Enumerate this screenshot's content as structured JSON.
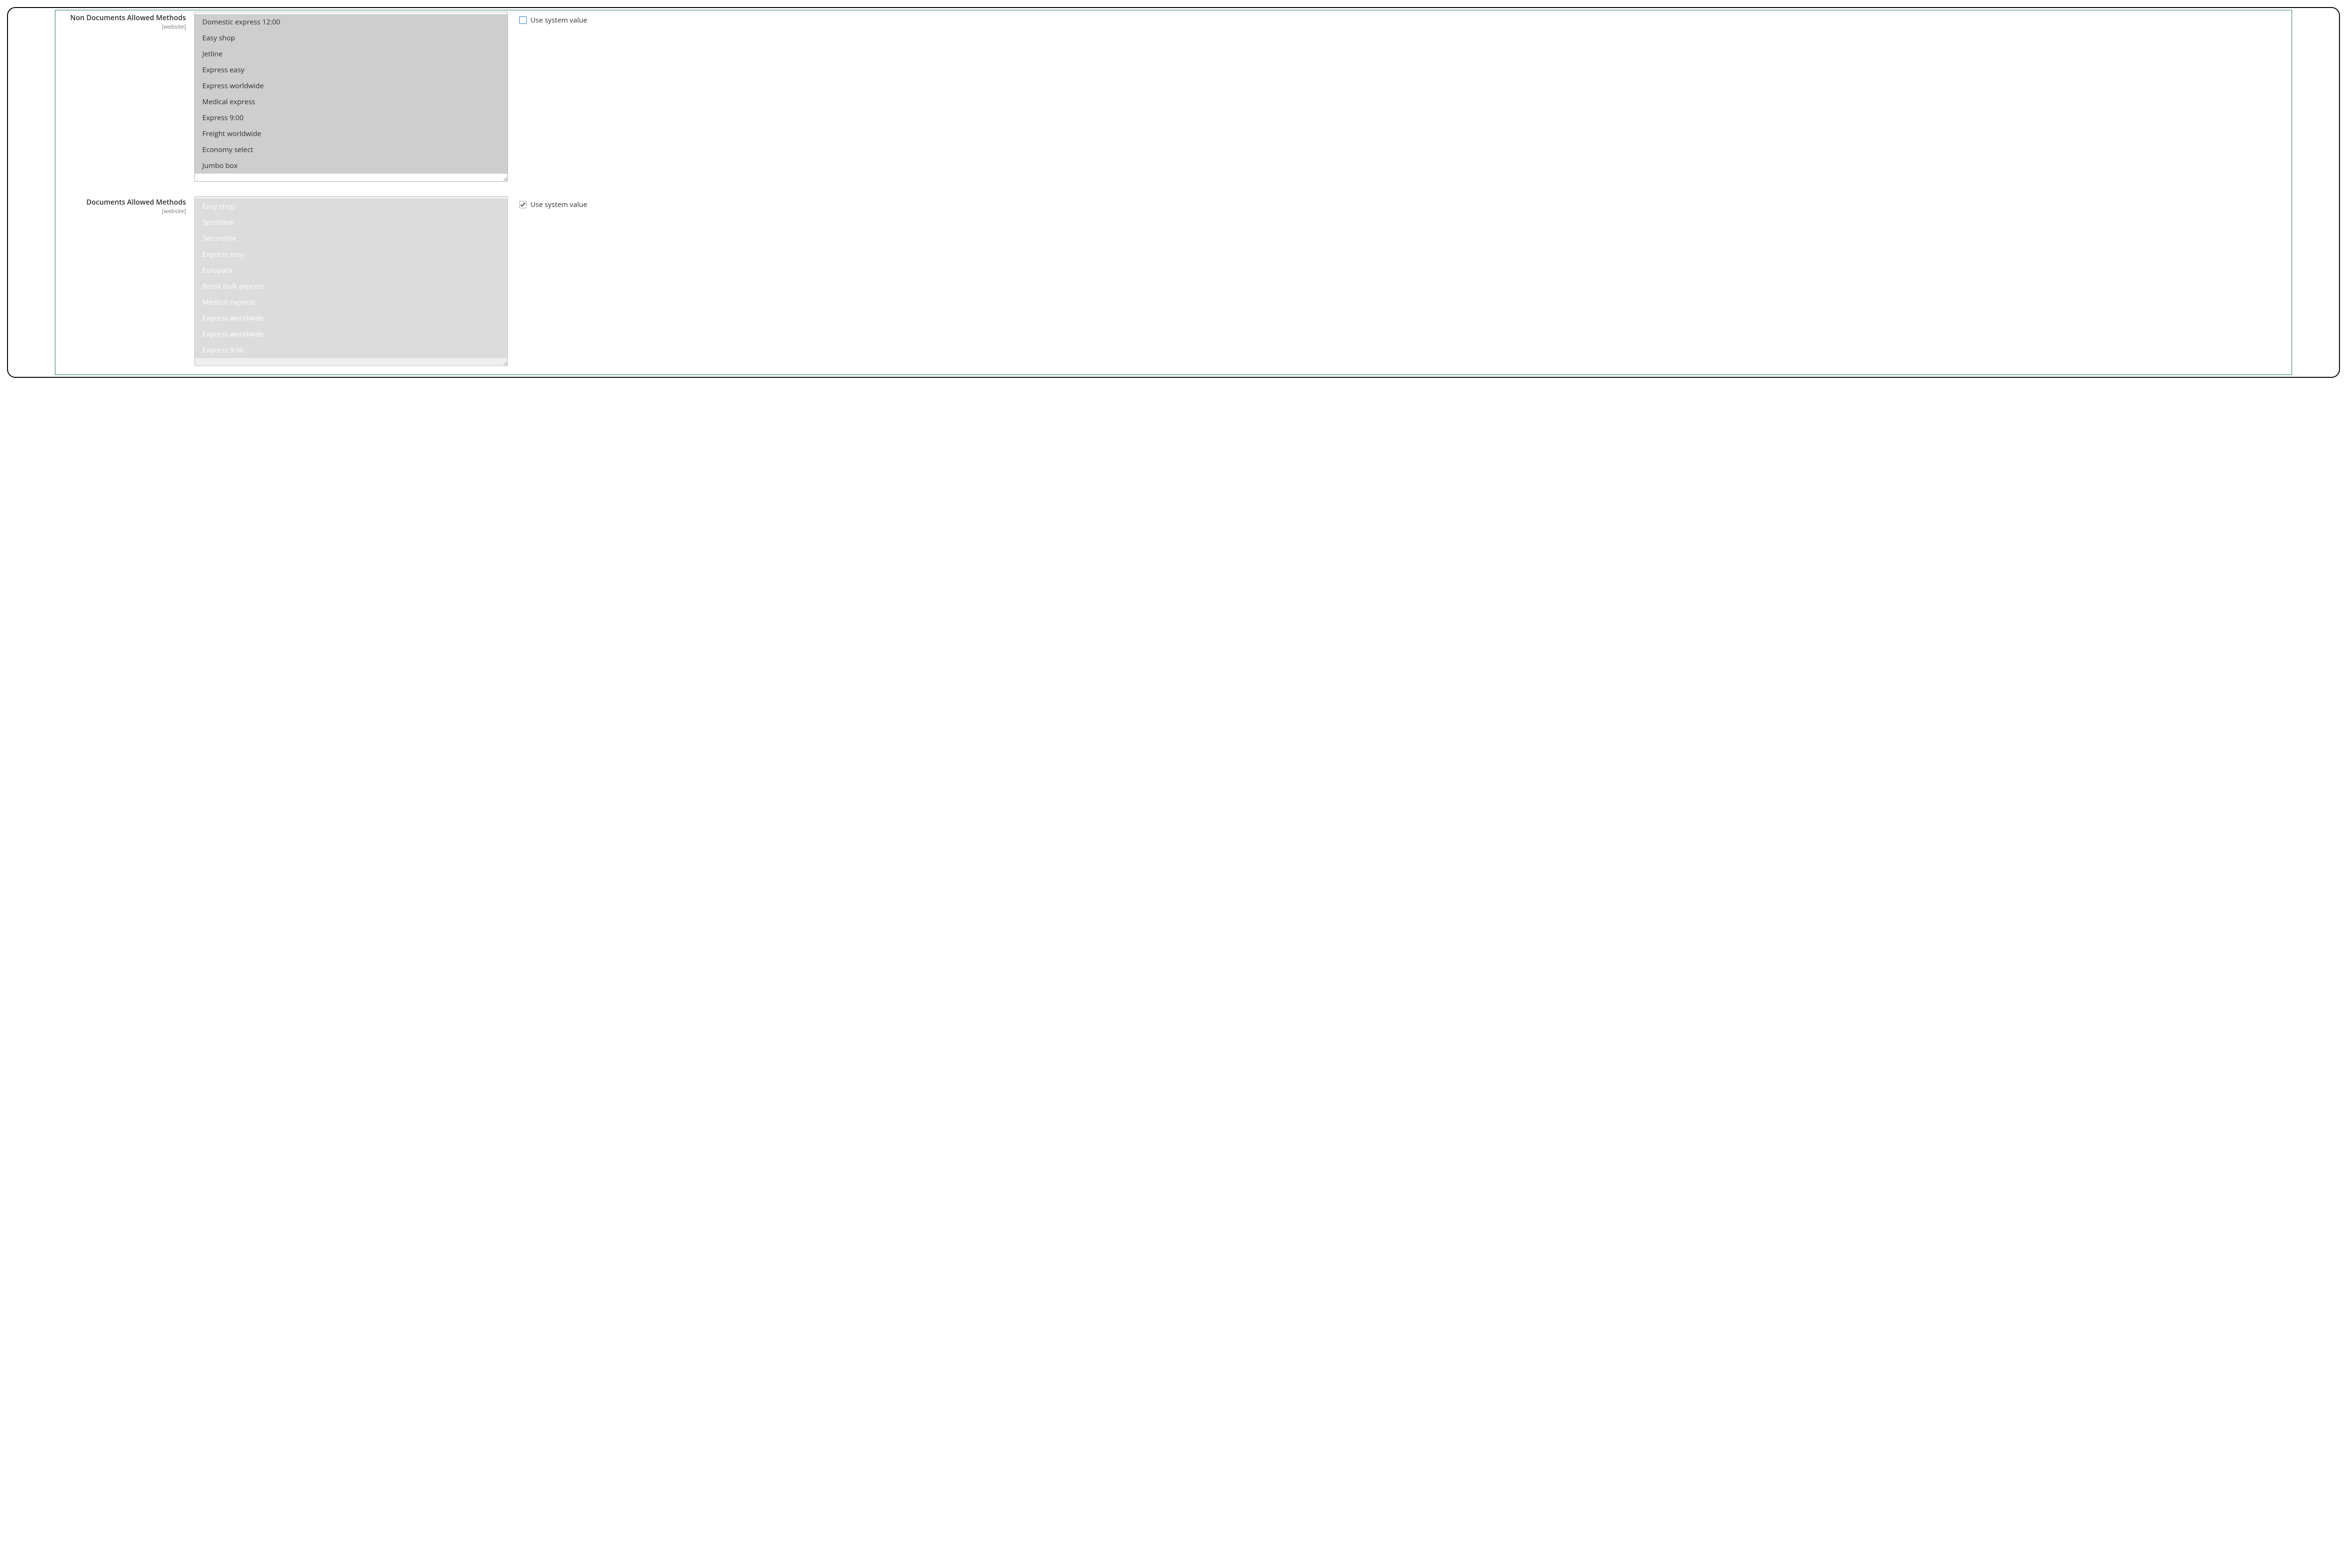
{
  "fields": {
    "nondoc": {
      "label": "Non Documents Allowed Methods",
      "scope": "[website]",
      "use_system_label": "Use system value",
      "use_system_checked": false,
      "options": [
        "Domestic express 12:00",
        "Easy shop",
        "Jetline",
        "Express easy",
        "Express worldwide",
        "Medical express",
        "Express 9:00",
        "Freight worldwide",
        "Economy select",
        "Jumbo box"
      ]
    },
    "doc": {
      "label": "Documents Allowed Methods",
      "scope": "[website]",
      "use_system_label": "Use system value",
      "use_system_checked": true,
      "options": [
        "Easy shop",
        "Sprintline",
        "Secureline",
        "Express easy",
        "Europack",
        "Break bulk express",
        "Medical express",
        "Express worldwide",
        "Express worldwide",
        "Express 9:00"
      ]
    }
  }
}
